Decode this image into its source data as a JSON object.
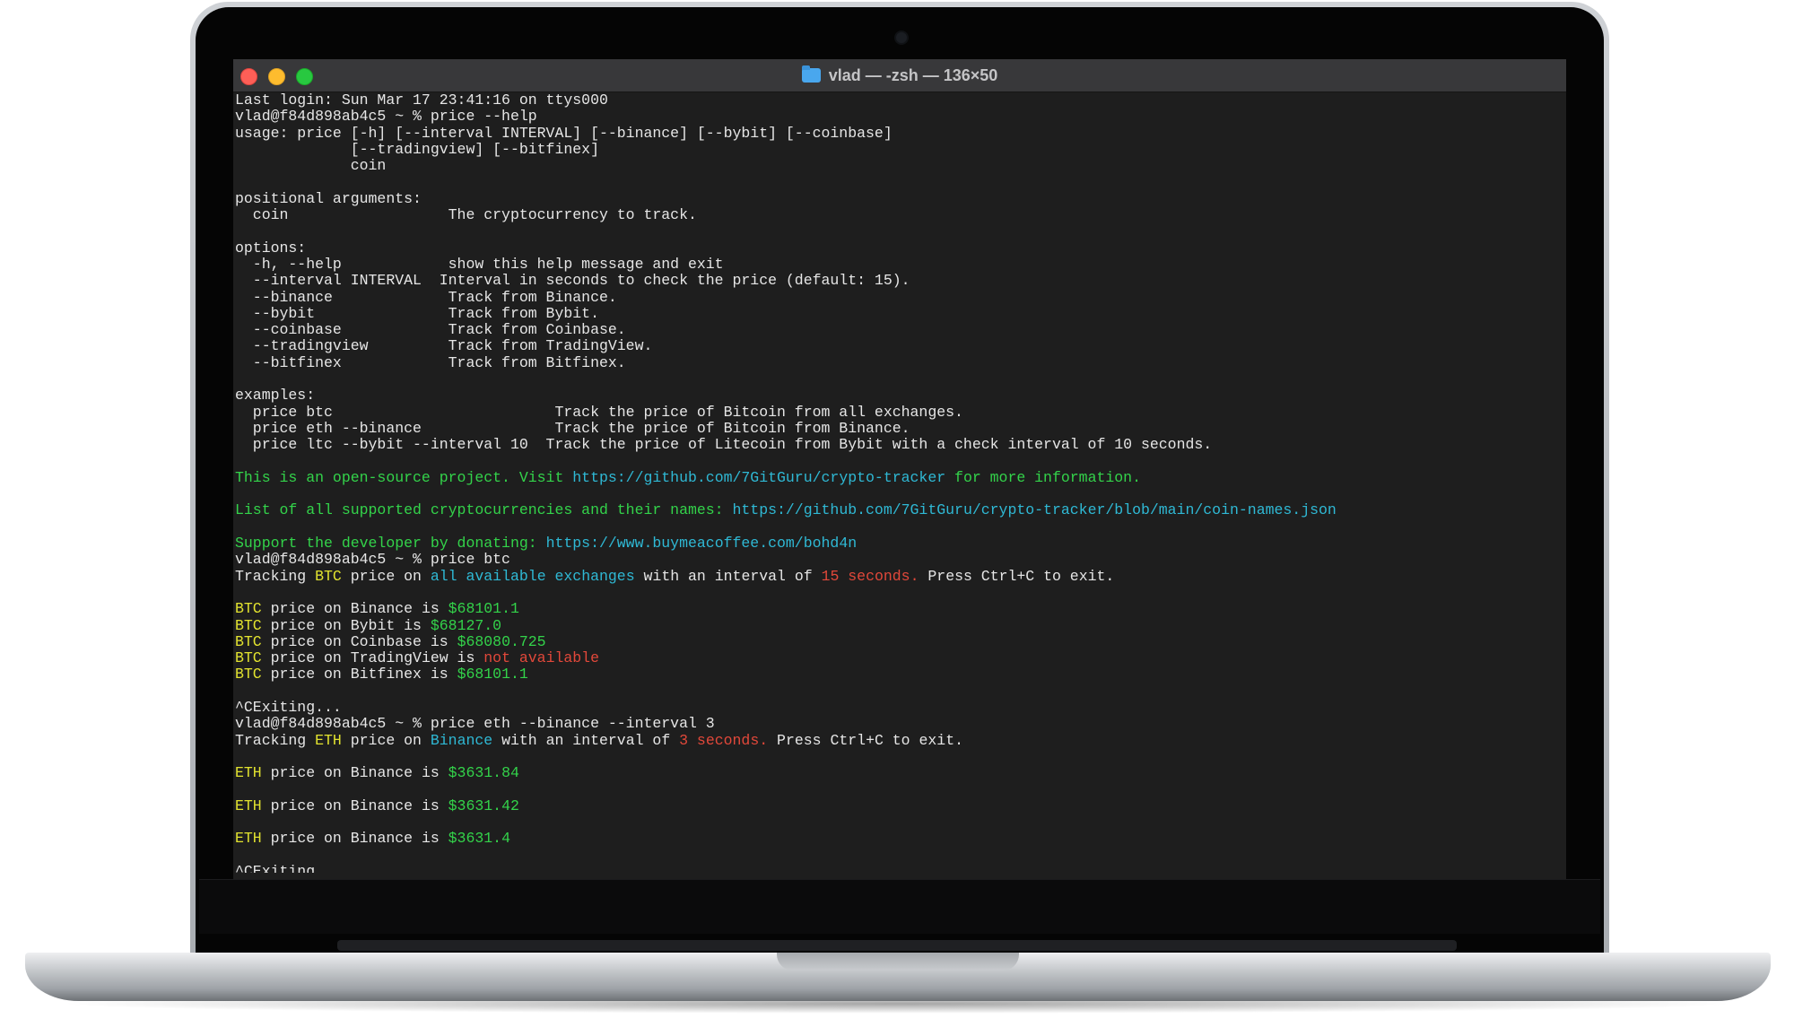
{
  "window": {
    "title": "vlad — -zsh — 136×50",
    "title_icon": "folder-icon",
    "traffic_lights": [
      "close",
      "minimize",
      "zoom"
    ]
  },
  "colors": {
    "background": "#1e1e1e",
    "text": "#e6e6e6",
    "green": "#33d34a",
    "cyan": "#2fb9d5",
    "yellow": "#e2e32f",
    "red": "#e2483a"
  },
  "terminal": {
    "lines": [
      [
        {
          "t": "Last login: Sun Mar 17 23:41:16 on ttys000",
          "c": "w"
        }
      ],
      [
        {
          "t": "vlad@f84d898ab4c5 ~ % price --help",
          "c": "w"
        }
      ],
      [
        {
          "t": "usage: price [-h] [--interval INTERVAL] [--binance] [--bybit] [--coinbase]",
          "c": "w"
        }
      ],
      [
        {
          "t": "             [--tradingview] [--bitfinex]",
          "c": "w"
        }
      ],
      [
        {
          "t": "             coin",
          "c": "w"
        }
      ],
      [],
      [
        {
          "t": "positional arguments:",
          "c": "w"
        }
      ],
      [
        {
          "t": "  coin                  The cryptocurrency to track.",
          "c": "w"
        }
      ],
      [],
      [
        {
          "t": "options:",
          "c": "w"
        }
      ],
      [
        {
          "t": "  -h, --help            show this help message and exit",
          "c": "w"
        }
      ],
      [
        {
          "t": "  --interval INTERVAL  Interval in seconds to check the price (default: 15).",
          "c": "w"
        }
      ],
      [
        {
          "t": "  --binance             Track from Binance.",
          "c": "w"
        }
      ],
      [
        {
          "t": "  --bybit               Track from Bybit.",
          "c": "w"
        }
      ],
      [
        {
          "t": "  --coinbase            Track from Coinbase.",
          "c": "w"
        }
      ],
      [
        {
          "t": "  --tradingview         Track from TradingView.",
          "c": "w"
        }
      ],
      [
        {
          "t": "  --bitfinex            Track from Bitfinex.",
          "c": "w"
        }
      ],
      [],
      [
        {
          "t": "examples:",
          "c": "w"
        }
      ],
      [
        {
          "t": "  price btc                         Track the price of Bitcoin from all exchanges.",
          "c": "w"
        }
      ],
      [
        {
          "t": "  price eth --binance               Track the price of Bitcoin from Binance.",
          "c": "w"
        }
      ],
      [
        {
          "t": "  price ltc --bybit --interval 10  Track the price of Litecoin from Bybit with a check interval of 10 seconds.",
          "c": "w"
        }
      ],
      [],
      [
        {
          "t": "This is an open-source project. Visit ",
          "c": "g"
        },
        {
          "t": "https://github.com/7GitGuru/crypto-tracker",
          "c": "c"
        },
        {
          "t": " for more information.",
          "c": "g"
        }
      ],
      [],
      [
        {
          "t": "List of all supported cryptocurrencies and their names: ",
          "c": "g"
        },
        {
          "t": "https://github.com/7GitGuru/crypto-tracker/blob/main/coin-names.json",
          "c": "c"
        }
      ],
      [],
      [
        {
          "t": "Support the developer by donating: ",
          "c": "g"
        },
        {
          "t": "https://www.buymeacoffee.com/bohd4n",
          "c": "c"
        }
      ],
      [
        {
          "t": "vlad@f84d898ab4c5 ~ % price btc",
          "c": "w"
        }
      ],
      [
        {
          "t": "Tracking ",
          "c": "w"
        },
        {
          "t": "BTC",
          "c": "y"
        },
        {
          "t": " price on ",
          "c": "w"
        },
        {
          "t": "all available exchanges",
          "c": "c"
        },
        {
          "t": " with an interval of ",
          "c": "w"
        },
        {
          "t": "15 seconds.",
          "c": "r"
        },
        {
          "t": " Press Ctrl+C to exit.",
          "c": "w"
        }
      ],
      [],
      [
        {
          "t": "BTC",
          "c": "y"
        },
        {
          "t": " price on Binance is ",
          "c": "w"
        },
        {
          "t": "$68101.1",
          "c": "g"
        }
      ],
      [
        {
          "t": "BTC",
          "c": "y"
        },
        {
          "t": " price on Bybit is ",
          "c": "w"
        },
        {
          "t": "$68127.0",
          "c": "g"
        }
      ],
      [
        {
          "t": "BTC",
          "c": "y"
        },
        {
          "t": " price on Coinbase is ",
          "c": "w"
        },
        {
          "t": "$68080.725",
          "c": "g"
        }
      ],
      [
        {
          "t": "BTC",
          "c": "y"
        },
        {
          "t": " price on TradingView is ",
          "c": "w"
        },
        {
          "t": "not available",
          "c": "r"
        }
      ],
      [
        {
          "t": "BTC",
          "c": "y"
        },
        {
          "t": " price on Bitfinex is ",
          "c": "w"
        },
        {
          "t": "$68101.1",
          "c": "g"
        }
      ],
      [],
      [
        {
          "t": "^CExiting...",
          "c": "w"
        }
      ],
      [
        {
          "t": "vlad@f84d898ab4c5 ~ % price eth --binance --interval 3",
          "c": "w"
        }
      ],
      [
        {
          "t": "Tracking ",
          "c": "w"
        },
        {
          "t": "ETH",
          "c": "y"
        },
        {
          "t": " price on ",
          "c": "w"
        },
        {
          "t": "Binance",
          "c": "c"
        },
        {
          "t": " with an interval of ",
          "c": "w"
        },
        {
          "t": "3 seconds.",
          "c": "r"
        },
        {
          "t": " Press Ctrl+C to exit.",
          "c": "w"
        }
      ],
      [],
      [
        {
          "t": "ETH",
          "c": "y"
        },
        {
          "t": " price on Binance is ",
          "c": "w"
        },
        {
          "t": "$3631.84",
          "c": "g"
        }
      ],
      [],
      [
        {
          "t": "ETH",
          "c": "y"
        },
        {
          "t": " price on Binance is ",
          "c": "w"
        },
        {
          "t": "$3631.42",
          "c": "g"
        }
      ],
      [],
      [
        {
          "t": "ETH",
          "c": "y"
        },
        {
          "t": " price on Binance is ",
          "c": "w"
        },
        {
          "t": "$3631.4",
          "c": "g"
        }
      ],
      [],
      [
        {
          "t": "^CExiting...",
          "c": "w"
        }
      ]
    ]
  }
}
